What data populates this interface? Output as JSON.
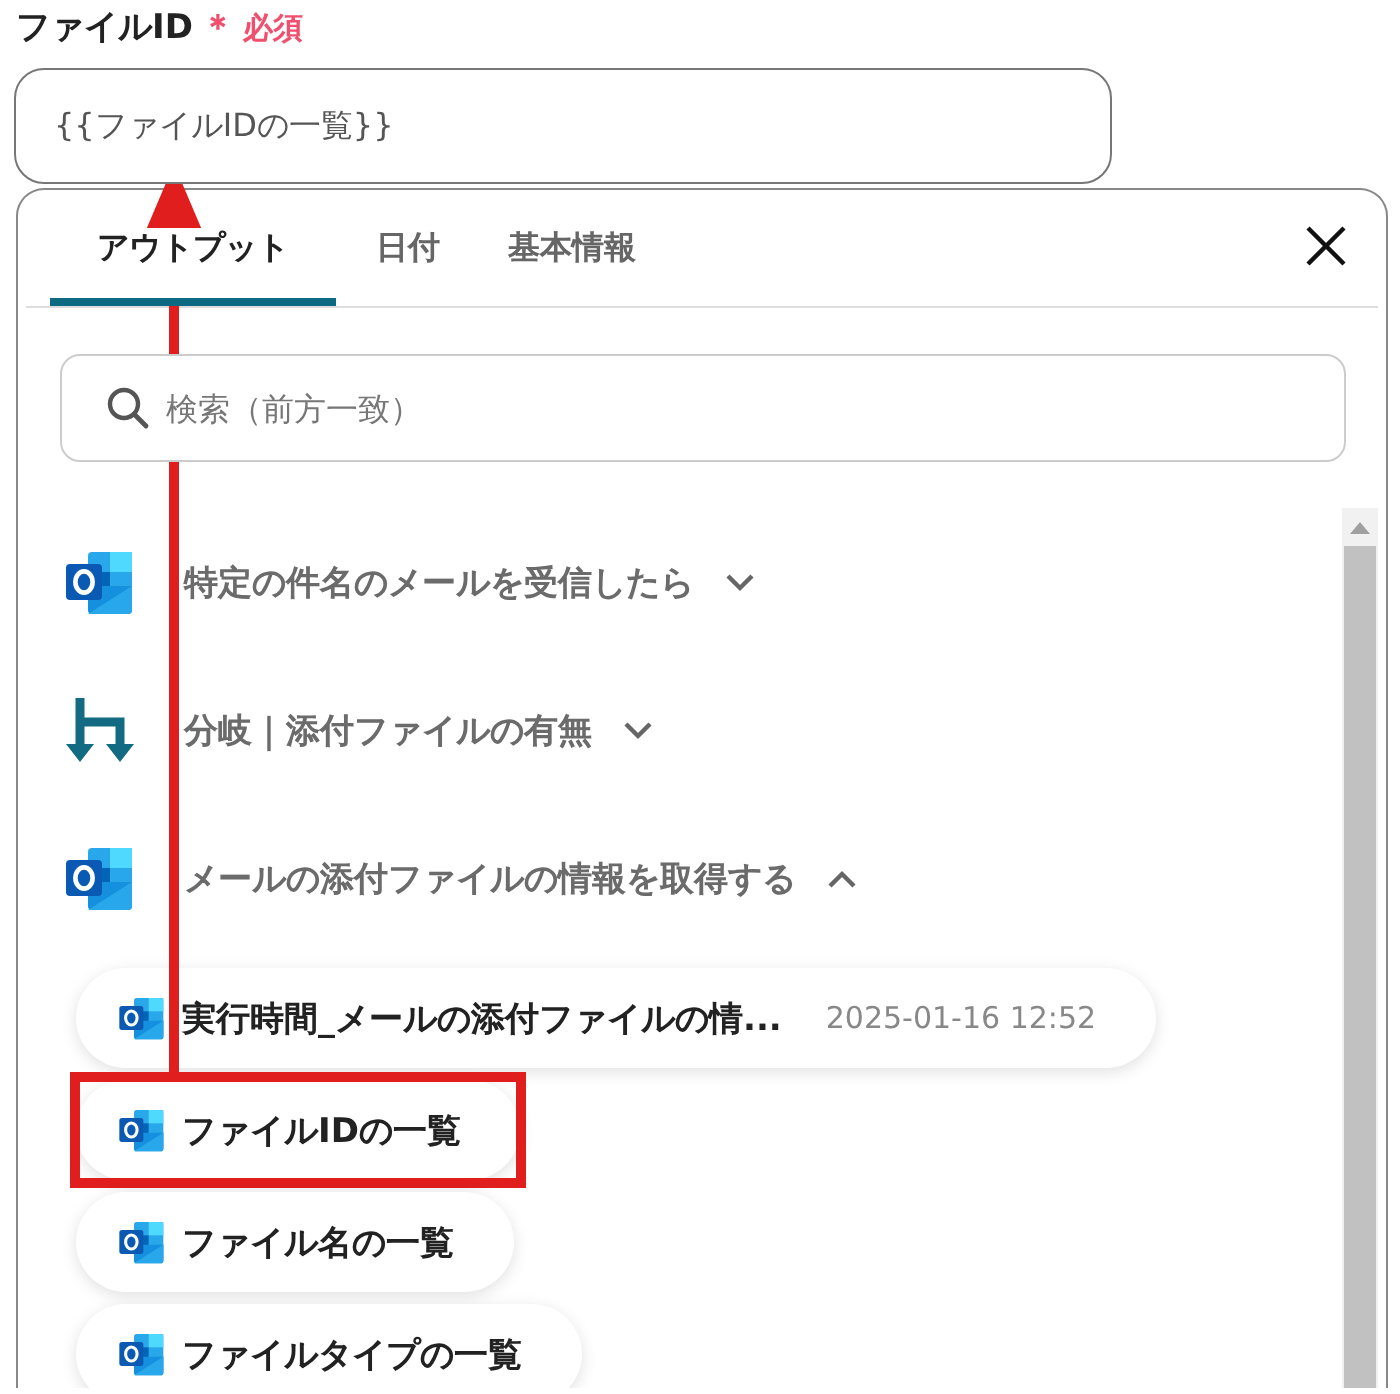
{
  "field": {
    "label": "ファイルID",
    "required_mark": "＊",
    "required_text": "必須",
    "value": "{{ファイルIDの一覧}}"
  },
  "tabs": [
    {
      "label": "アウトプット",
      "selected": true
    },
    {
      "label": "日付",
      "selected": false
    },
    {
      "label": "基本情報",
      "selected": false
    }
  ],
  "search": {
    "placeholder": "検索（前方一致）"
  },
  "groups": [
    {
      "kind": "outlook",
      "title": "特定の件名のメールを受信したら",
      "expanded": false
    },
    {
      "kind": "branch",
      "title": "分岐｜添付ファイルの有無",
      "expanded": false
    },
    {
      "kind": "outlook",
      "title": "メールの添付ファイルの情報を取得する",
      "expanded": true,
      "items": [
        {
          "label": "実行時間_メールの添付ファイルの情...",
          "value": "2025-01-16 12:52",
          "highlighted": false
        },
        {
          "label": "ファイルIDの一覧",
          "highlighted": true
        },
        {
          "label": "ファイル名の一覧",
          "highlighted": false
        },
        {
          "label": "ファイルタイプの一覧",
          "highlighted": false
        }
      ]
    }
  ]
}
